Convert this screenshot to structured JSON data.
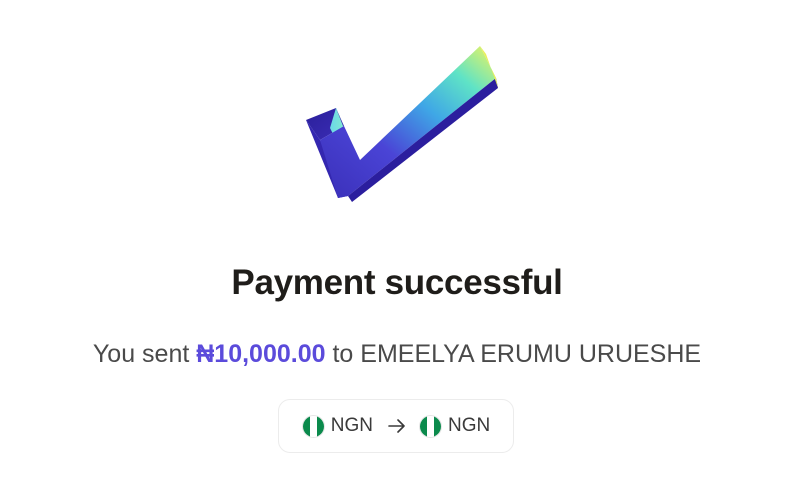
{
  "title": "Payment successful",
  "summary": {
    "prefix": "You sent ",
    "amount": "₦10,000.00",
    "middle": " to ",
    "recipient": "EMEELYA ERUMU URUESHE"
  },
  "conversion": {
    "from_currency": "NGN",
    "to_currency": "NGN",
    "from_flag": "nigeria-flag-icon",
    "to_flag": "nigeria-flag-icon",
    "arrow": "arrow-right-icon"
  },
  "colors": {
    "amount_accent": "#5b4bdb",
    "title_text": "#1f1d1a",
    "body_text": "#4a4a4a",
    "flag_green": "#0b8a4c"
  },
  "hero_icon": "success-checkmark-icon"
}
